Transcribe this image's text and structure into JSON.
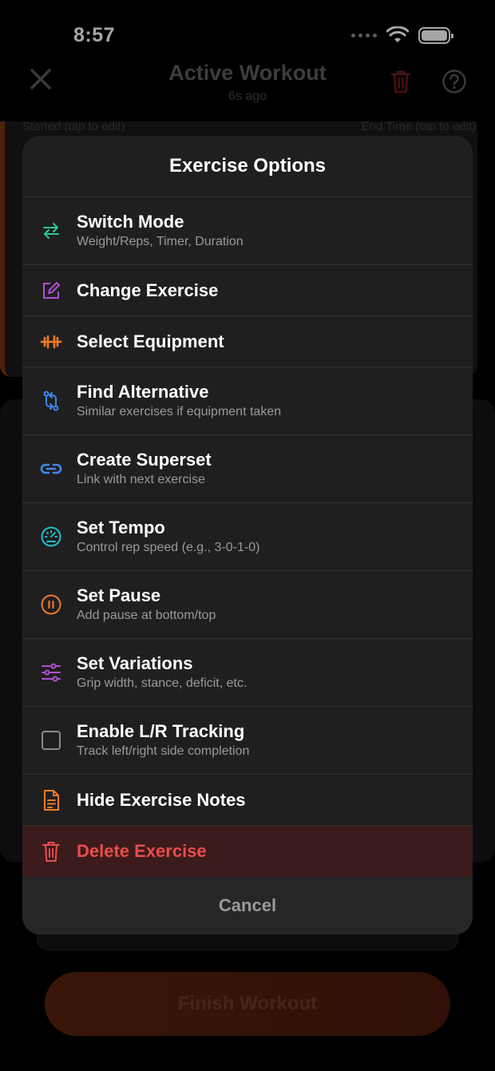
{
  "status_bar": {
    "time": "8:57"
  },
  "nav": {
    "title": "Active Workout",
    "subtitle": "6s ago"
  },
  "background": {
    "started_label": "Started (tap to edit)",
    "end_label": "End Time (tap to edit)",
    "finish_label": "Finish Workout"
  },
  "sheet": {
    "title": "Exercise Options",
    "options": [
      {
        "label": "Switch Mode",
        "desc": "Weight/Reps, Timer, Duration",
        "icon": "switch-arrows-icon",
        "color": "#2fc98f"
      },
      {
        "label": "Change Exercise",
        "desc": "",
        "icon": "edit-square-icon",
        "color": "#b04fd6"
      },
      {
        "label": "Select Equipment",
        "desc": "",
        "icon": "dumbbell-icon",
        "color": "#f07a2a"
      },
      {
        "label": "Find Alternative",
        "desc": "Similar exercises if equipment taken",
        "icon": "swap-vertical-icon",
        "color": "#3f86f0"
      },
      {
        "label": "Create Superset",
        "desc": "Link with next exercise",
        "icon": "link-icon",
        "color": "#3f86f0"
      },
      {
        "label": "Set Tempo",
        "desc": "Control rep speed (e.g., 3-0-1-0)",
        "icon": "gauge-icon",
        "color": "#1fbfd1"
      },
      {
        "label": "Set Pause",
        "desc": "Add pause at bottom/top",
        "icon": "pause-circle-icon",
        "color": "#f07a2a"
      },
      {
        "label": "Set Variations",
        "desc": "Grip width, stance, deficit, etc.",
        "icon": "sliders-icon",
        "color": "#b04fd6"
      },
      {
        "label": "Enable L/R Tracking",
        "desc": "Track left/right side completion",
        "icon": "checkbox-icon",
        "color": "#8a8a8a"
      },
      {
        "label": "Hide Exercise Notes",
        "desc": "",
        "icon": "document-icon",
        "color": "#f07a2a"
      },
      {
        "label": "Delete Exercise",
        "desc": "",
        "icon": "trash-icon",
        "color": "#ea4c4c"
      }
    ],
    "cancel_label": "Cancel"
  }
}
